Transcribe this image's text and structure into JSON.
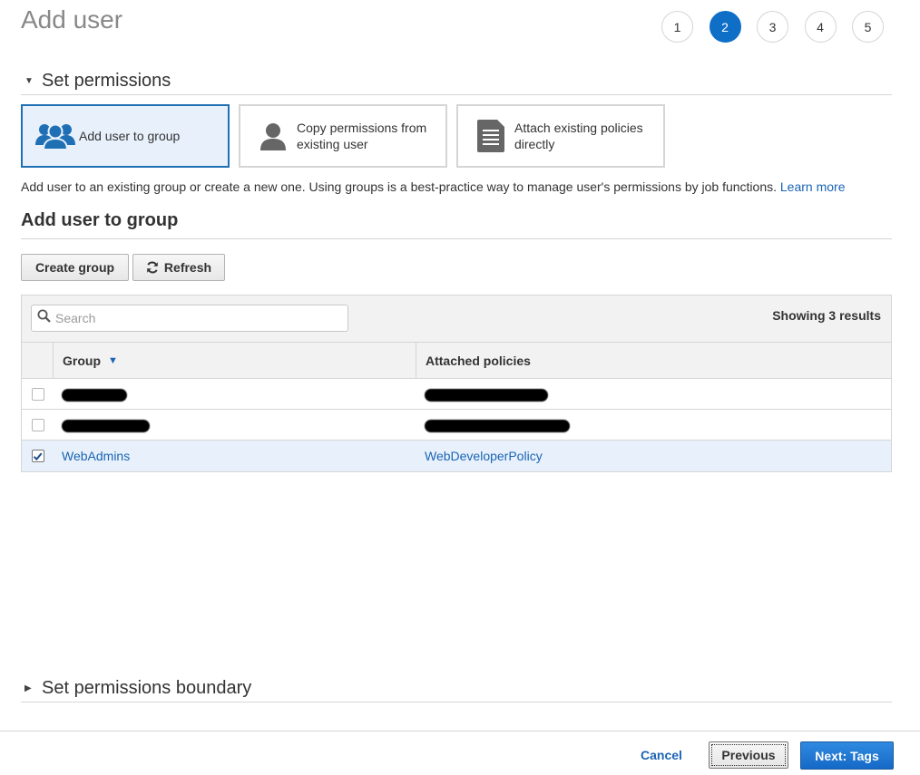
{
  "header": {
    "title": "Add user",
    "steps": [
      "1",
      "2",
      "3",
      "4",
      "5"
    ],
    "active_step": "2"
  },
  "permissions": {
    "section_title": "Set permissions",
    "options": [
      {
        "label_line1": "Add user to group",
        "label_line2": "",
        "icon": "user-group-icon",
        "selected": true
      },
      {
        "label_line1": "Copy permissions from",
        "label_line2": "existing user",
        "icon": "user-icon",
        "selected": false
      },
      {
        "label_line1": "Attach existing policies",
        "label_line2": "directly",
        "icon": "document-icon",
        "selected": false
      }
    ],
    "help_text": "Add user to an existing group or create a new one. Using groups is a best-practice way to manage user's permissions by job functions.",
    "learn_more": "Learn more"
  },
  "group_section": {
    "title": "Add user to group",
    "create_group_label": "Create group",
    "refresh_label": "Refresh",
    "search_placeholder": "Search",
    "results_text": "Showing 3 results",
    "columns": {
      "group": "Group",
      "policies": "Attached policies"
    },
    "rows": [
      {
        "group": "",
        "policy": "",
        "redacted": true,
        "checked": false
      },
      {
        "group": "",
        "policy": "",
        "redacted": true,
        "checked": false
      },
      {
        "group": "WebAdmins",
        "policy": "WebDeveloperPolicy",
        "redacted": false,
        "checked": true
      }
    ]
  },
  "boundary": {
    "section_title": "Set permissions boundary"
  },
  "footer": {
    "cancel_label": "Cancel",
    "previous_label": "Previous",
    "next_label": "Next: Tags"
  },
  "colors": {
    "accent": "#0f6fc6",
    "link": "#1a64b4",
    "selected_bg": "#e8f1fb"
  }
}
